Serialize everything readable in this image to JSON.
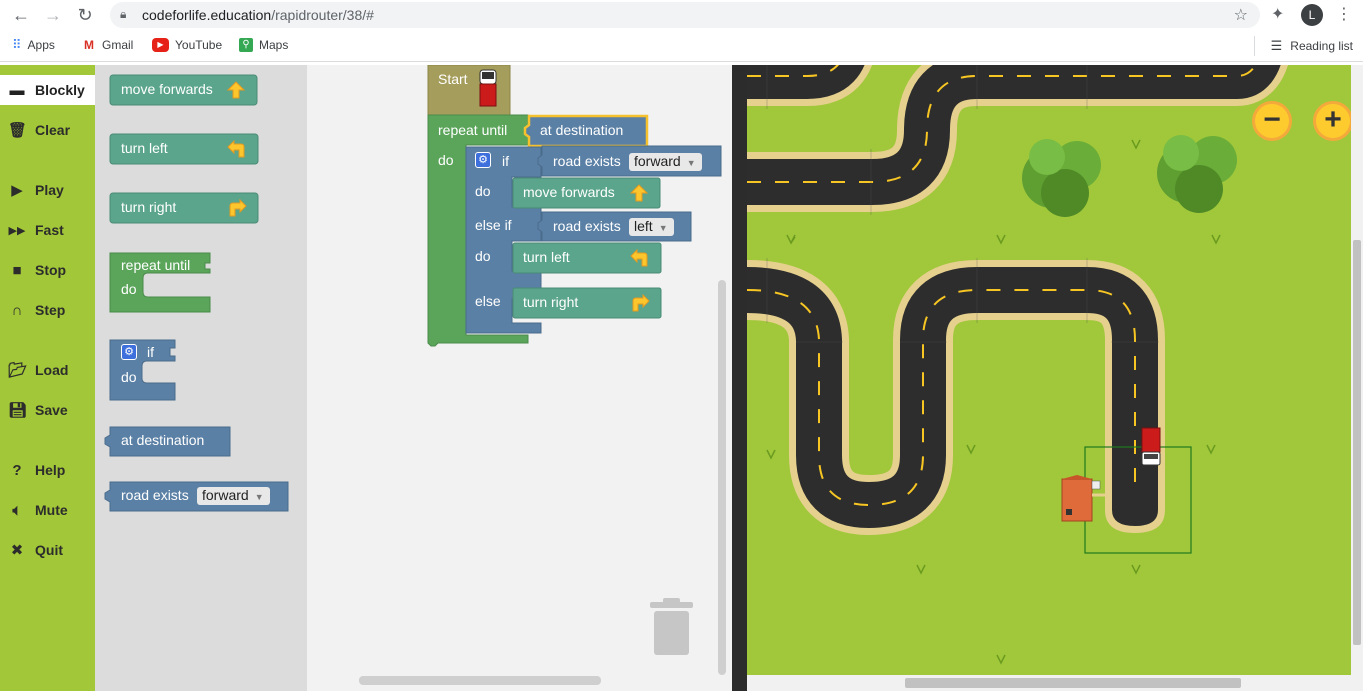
{
  "browser": {
    "url_domain": "codeforlife.education",
    "url_path": "/rapidrouter/38/#",
    "profile_initial": "L",
    "bookmarks": [
      {
        "label": "Apps",
        "icon": "apps-grid-icon"
      },
      {
        "label": "Gmail",
        "icon": "gmail-icon"
      },
      {
        "label": "YouTube",
        "icon": "youtube-icon"
      },
      {
        "label": "Maps",
        "icon": "maps-icon"
      }
    ],
    "reading_list": "Reading list"
  },
  "sidebar": {
    "items": [
      {
        "label": "Blockly",
        "icon": "blockly-icon",
        "active": true
      },
      {
        "label": "Clear",
        "icon": "trash-icon"
      },
      {
        "label": "Play",
        "icon": "play-icon"
      },
      {
        "label": "Fast",
        "icon": "fast-forward-icon"
      },
      {
        "label": "Stop",
        "icon": "stop-icon"
      },
      {
        "label": "Step",
        "icon": "step-icon"
      },
      {
        "label": "Load",
        "icon": "folder-icon"
      },
      {
        "label": "Save",
        "icon": "save-icon"
      },
      {
        "label": "Help",
        "icon": "help-icon"
      },
      {
        "label": "Mute",
        "icon": "speaker-icon"
      },
      {
        "label": "Quit",
        "icon": "quit-icon"
      }
    ]
  },
  "toolbox": {
    "move_forwards": "move forwards",
    "turn_left": "turn left",
    "turn_right": "turn right",
    "repeat_until": "repeat until",
    "do": "do",
    "if": "if",
    "at_destination": "at destination",
    "road_exists": "road exists",
    "road_exists_option": "forward"
  },
  "program": {
    "start": "Start",
    "repeat_until": "repeat until",
    "condition": "at destination",
    "do": "do",
    "if": "if",
    "road_exists": "road exists",
    "if_direction": "forward",
    "do_if": "do",
    "move_forwards": "move forwards",
    "else_if": "else if",
    "elseif_direction": "left",
    "do_elseif": "do",
    "turn_left": "turn left",
    "else": "else",
    "turn_right": "turn right"
  },
  "map": {
    "zoom_out": "−",
    "zoom_in": "+",
    "colors": {
      "grass": "#a0c83a",
      "road": "#2d2d2d",
      "kerb": "#e6d08e",
      "lane": "#f7c623",
      "van": "#cc1b1b",
      "house": "#e06b3a"
    }
  }
}
